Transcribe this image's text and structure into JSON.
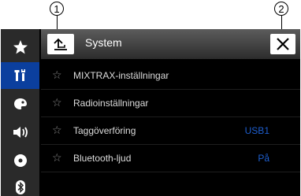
{
  "callouts": {
    "first": "1",
    "second": "2"
  },
  "header": {
    "title": "System"
  },
  "sidebar": {
    "items": [
      {
        "icon": "star-icon",
        "active": false
      },
      {
        "icon": "tools-icon",
        "active": true
      },
      {
        "icon": "palette-icon",
        "active": false
      },
      {
        "icon": "speaker-icon",
        "active": false
      },
      {
        "icon": "disc-icon",
        "active": false
      },
      {
        "icon": "bluetooth-icon",
        "active": false
      }
    ]
  },
  "menu": {
    "items": [
      {
        "label": "MIXTRAX-inställningar",
        "value": ""
      },
      {
        "label": "Radioinställningar",
        "value": ""
      },
      {
        "label": "Taggöverföring",
        "value": "USB1"
      },
      {
        "label": "Bluetooth-ljud",
        "value": "På"
      }
    ]
  },
  "colors": {
    "accent": "#0b3f9e",
    "value_text": "#1e5fd0"
  }
}
